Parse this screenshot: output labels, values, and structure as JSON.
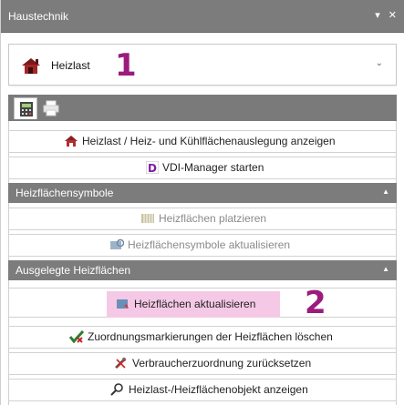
{
  "panel": {
    "title": "Haustechnik",
    "controls": "▾ ✕"
  },
  "dropdown": {
    "label": "Heizlast",
    "chevron": "⌄"
  },
  "callouts": [
    "1",
    "2"
  ],
  "tabs": [
    {
      "name": "calculator-tab",
      "icon": "calculator-icon",
      "active": true
    },
    {
      "name": "printer-tab",
      "icon": "printer-icon",
      "active": false
    }
  ],
  "commands": {
    "show_heating": "Heizlast / Heiz- und Kühlflächenauslegung anzeigen",
    "vdi_manager": "VDI-Manager starten"
  },
  "sections": {
    "symbols": {
      "title": "Heizflächensymbole",
      "items": [
        "Heizflächen platzieren",
        "Heizflächensymbole aktualisieren"
      ]
    },
    "laid_out": {
      "title": "Ausgelegte Heizflächen",
      "items": [
        "Heizflächen aktualisieren",
        "Zuordnungsmarkierungen der Heizflächen löschen",
        "Verbraucherzuordnung zurücksetzen",
        "Heizlast-/Heizflächenobjekt anzeigen"
      ]
    }
  },
  "colors": {
    "accent": "#9b1b7e",
    "highlight": "#f5c9e6",
    "header": "#7c7c7c"
  }
}
